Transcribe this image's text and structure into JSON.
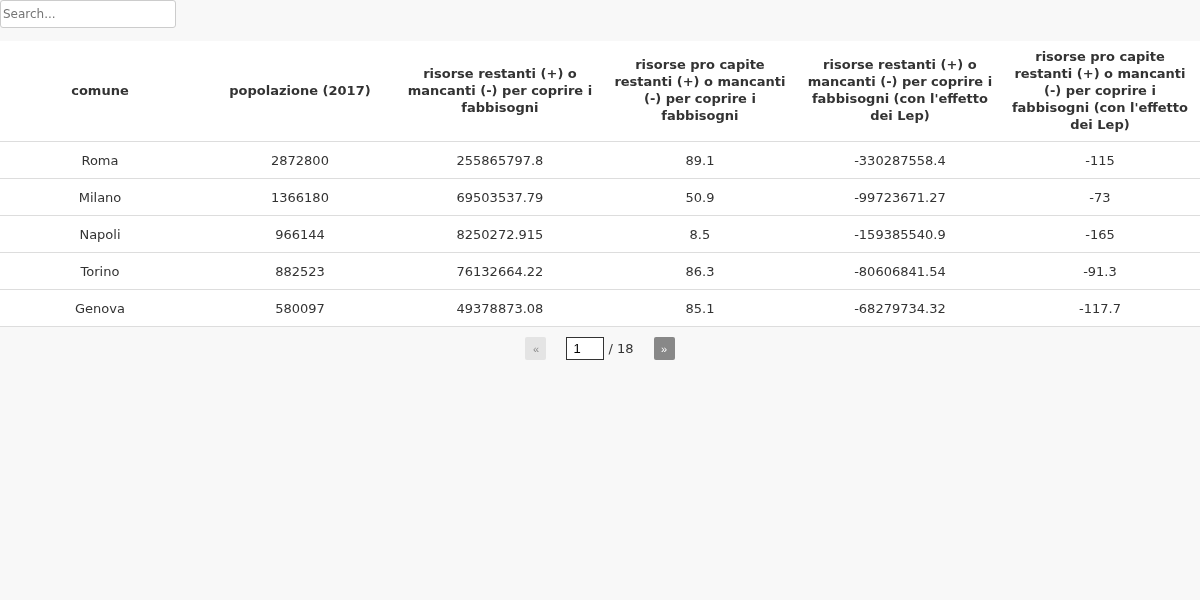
{
  "search": {
    "placeholder": "Search..."
  },
  "table": {
    "columns": [
      "comune",
      "popolazione (2017)",
      "risorse restanti (+) o mancanti (-) per coprire i fabbisogni",
      "risorse pro capite restanti (+) o mancanti (-) per coprire i fabbisogni",
      "risorse restanti (+) o mancanti (-) per coprire i fabbisogni (con l'effetto dei Lep)",
      "risorse pro capite restanti (+) o mancanti (-) per coprire i fabbisogni (con l'effetto dei Lep)"
    ],
    "rows": [
      [
        "Roma",
        "2872800",
        "255865797.8",
        "89.1",
        "-330287558.4",
        "-115"
      ],
      [
        "Milano",
        "1366180",
        "69503537.79",
        "50.9",
        "-99723671.27",
        "-73"
      ],
      [
        "Napoli",
        "966144",
        "8250272.915",
        "8.5",
        "-159385540.9",
        "-165"
      ],
      [
        "Torino",
        "882523",
        "76132664.22",
        "86.3",
        "-80606841.54",
        "-91.3"
      ],
      [
        "Genova",
        "580097",
        "49378873.08",
        "85.1",
        "-68279734.32",
        "-117.7"
      ]
    ]
  },
  "pagination": {
    "prev": {
      "label": "«",
      "disabled": true
    },
    "page": "1",
    "total": "/ 18",
    "next": {
      "label": "»",
      "disabled": false
    }
  }
}
